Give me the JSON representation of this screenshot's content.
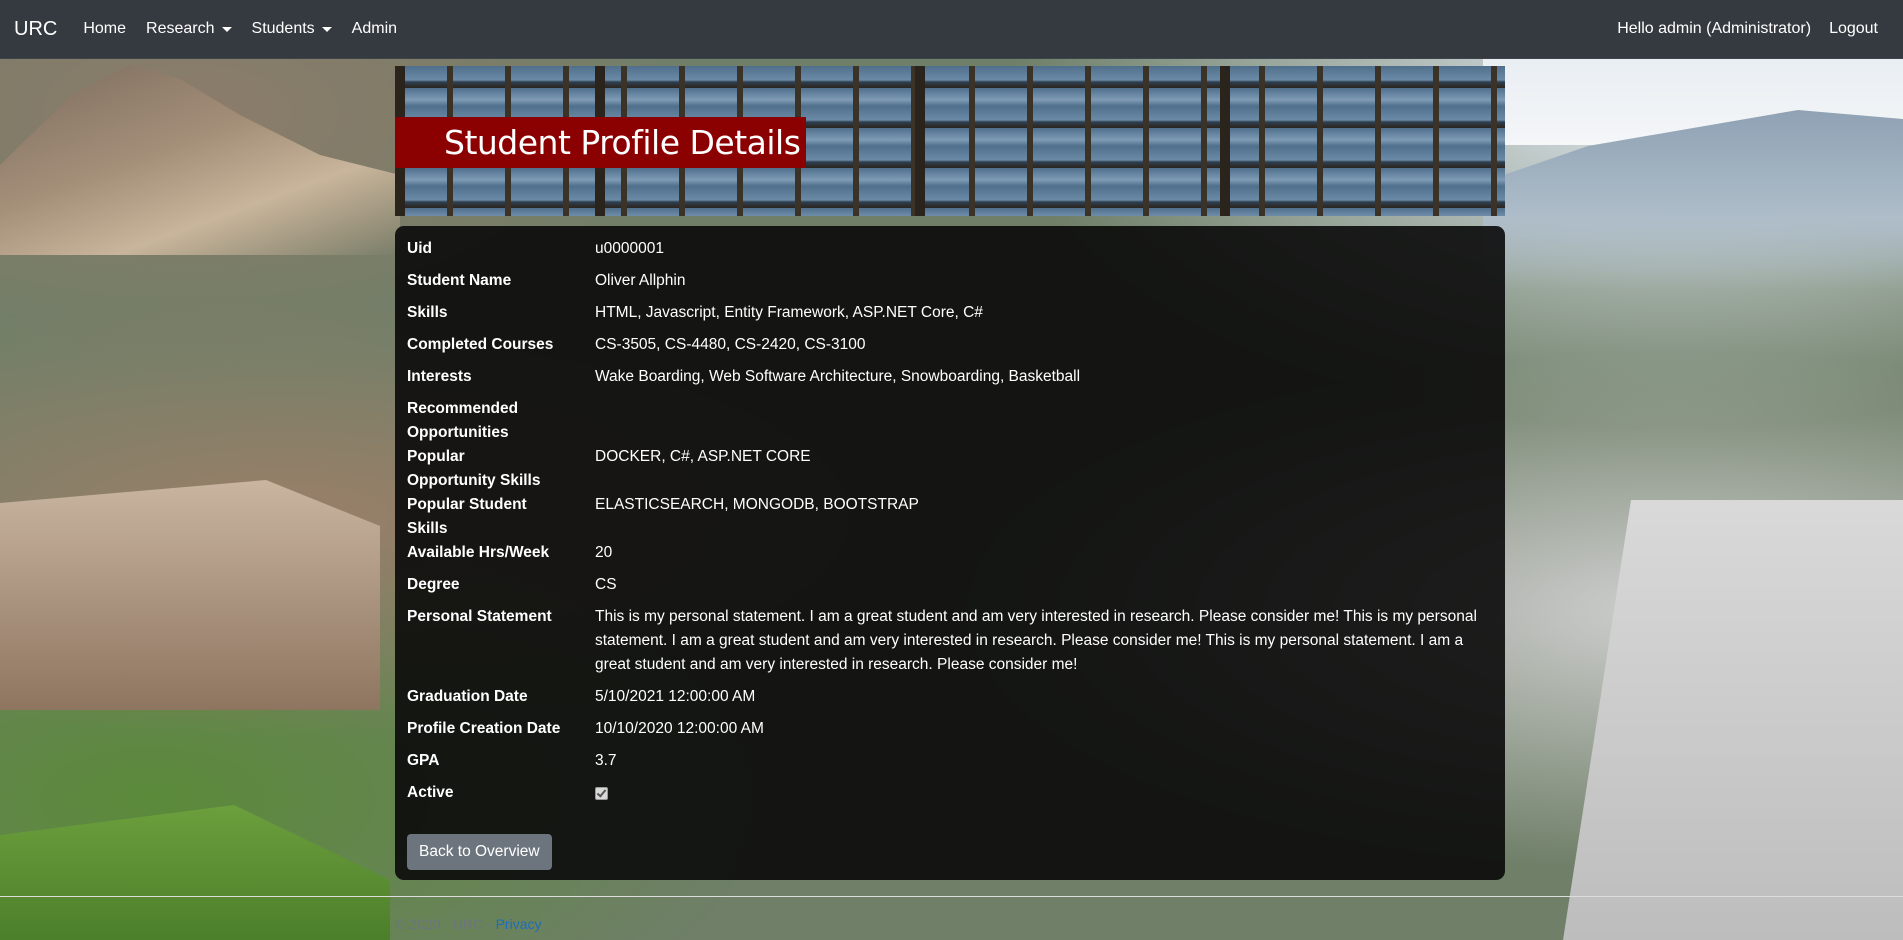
{
  "navbar": {
    "brand": "URC",
    "items": [
      {
        "label": "Home"
      },
      {
        "label": "Research"
      },
      {
        "label": "Students"
      },
      {
        "label": "Admin"
      }
    ],
    "greeting": "Hello admin (Administrator)",
    "logout": "Logout"
  },
  "banner": {
    "title": "Student Profile Details"
  },
  "details": [
    {
      "label": "Uid",
      "value": "u0000001"
    },
    {
      "label": "Student Name",
      "value": "Oliver Allphin"
    },
    {
      "label": "Skills",
      "value": "HTML, Javascript, Entity Framework, ASP.NET Core, C#"
    },
    {
      "label": "Completed Courses",
      "value": "CS-3505, CS-4480, CS-2420, CS-3100"
    },
    {
      "label": "Interests",
      "value": "Wake Boarding, Web Software Architecture, Snowboarding, Basketball"
    },
    {
      "label": "Recommended Opportunities",
      "value": ""
    },
    {
      "label": "Popular Opportunity Skills",
      "value": "DOCKER, C#, ASP.NET CORE"
    },
    {
      "label": "Popular Student Skills",
      "value": "ELASTICSEARCH, MONGODB, BOOTSTRAP"
    },
    {
      "label": "Available Hrs/Week",
      "value": "20"
    },
    {
      "label": "Degree",
      "value": "CS"
    },
    {
      "label": "Personal Statement",
      "value": "This is my personal statement. I am a great student and am very interested in research. Please consider me! This is my personal statement. I am a great student and am very interested in research. Please consider me! This is my personal statement. I am a great student and am very interested in research. Please consider me!"
    },
    {
      "label": "Graduation Date",
      "value": "5/10/2021 12:00:00 AM"
    },
    {
      "label": "Profile Creation Date",
      "value": "10/10/2020 12:00:00 AM"
    },
    {
      "label": "GPA",
      "value": "3.7"
    },
    {
      "label": "Active",
      "checked": true
    }
  ],
  "actions": {
    "back_label": "Back to Overview"
  },
  "footer": {
    "text": "© 2020 - URC - ",
    "privacy": "Privacy"
  }
}
